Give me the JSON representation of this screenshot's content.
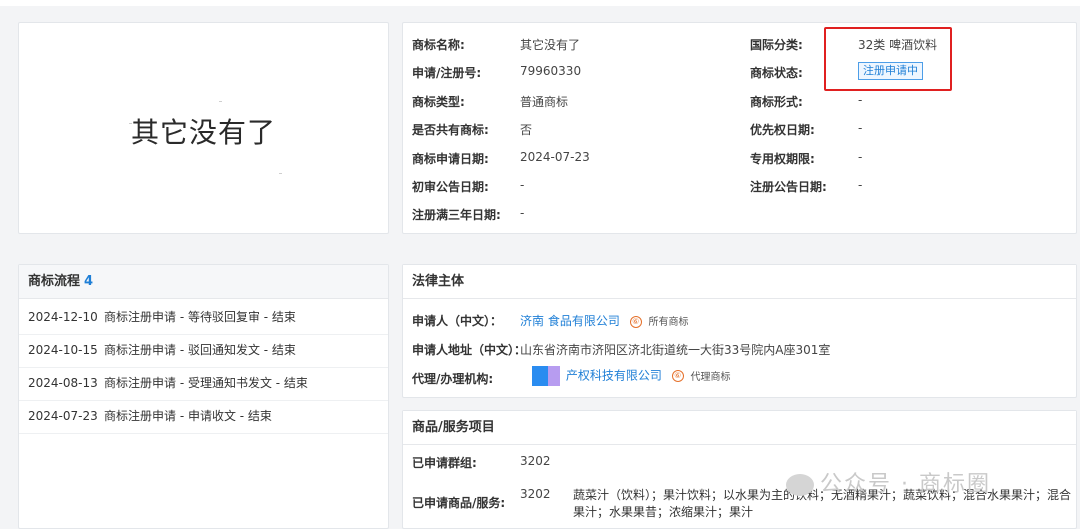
{
  "image_panel": {
    "mark_text": "其它没有了"
  },
  "info": {
    "left": [
      {
        "label": "商标名称:",
        "value": "其它没有了"
      },
      {
        "label": "申请/注册号:",
        "value": "79960330"
      },
      {
        "label": "商标类型:",
        "value": "普通商标"
      },
      {
        "label": "是否共有商标:",
        "value": "否"
      },
      {
        "label": "商标申请日期:",
        "value": "2024-07-23"
      },
      {
        "label": "初审公告日期:",
        "value": "-"
      },
      {
        "label": "注册满三年日期:",
        "value": "-"
      }
    ],
    "right": [
      {
        "label": "国际分类:",
        "value": "32类 啤酒饮料"
      },
      {
        "label": "商标状态:",
        "value": "注册申请中"
      },
      {
        "label": "商标形式:",
        "value": "-"
      },
      {
        "label": "优先权日期:",
        "value": "-"
      },
      {
        "label": "专用权期限:",
        "value": "-"
      },
      {
        "label": "注册公告日期:",
        "value": "-"
      }
    ],
    "highlight_color": "#e02020"
  },
  "flow": {
    "title": "商标流程",
    "count": "4",
    "items": [
      {
        "date": "2024-12-10",
        "text": "商标注册申请 - 等待驳回复审 - 结束"
      },
      {
        "date": "2024-10-15",
        "text": "商标注册申请 - 驳回通知发文 - 结束"
      },
      {
        "date": "2024-08-13",
        "text": "商标注册申请 - 受理通知书发文 - 结束"
      },
      {
        "date": "2024-07-23",
        "text": "商标注册申请 - 申请收文 - 结束"
      }
    ]
  },
  "legal": {
    "title": "法律主体",
    "applicant_label": "申请人（中文）：",
    "applicant_value": "济南          食品有限公司",
    "applicant_badge": "所有商标",
    "address_label": "申请人地址（中文）：",
    "address_value": "山东省济南市济阳区济北街道统一大街33号院内A座301室",
    "agent_label": "代理/办理机构:",
    "agent_value": "产权科技有限公司",
    "agent_badge": "代理商标",
    "badge_icon_glyph": "⑥"
  },
  "goods": {
    "title": "商品/服务项目",
    "group_label": "已申请群组:",
    "group_value": "3202",
    "items_label": "已申请商品/服务:",
    "items_code": "3202",
    "items_desc": "蔬菜汁（饮料）；果汁饮料；以水果为主的饮料；无酒精果汁；蔬菜饮料；混合水果果汁；混合果汁；水果果昔；浓缩果汁；果汁"
  },
  "watermark": {
    "text": "公众号 · 商标圈"
  },
  "colors": {
    "accent": "#1f7fd6",
    "border": "#e3e6ea",
    "background": "#f3f4f6"
  }
}
